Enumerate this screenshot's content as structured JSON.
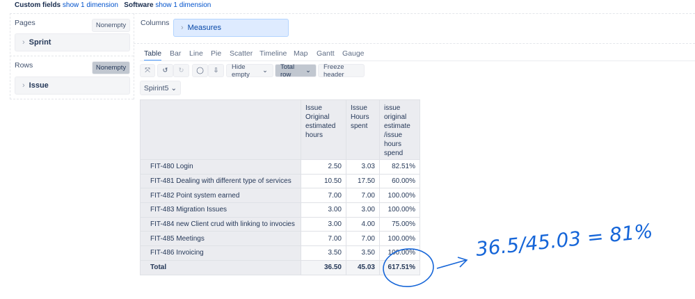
{
  "top_bar": [
    {
      "label": "Custom fields",
      "link": "show 1 dimension"
    },
    {
      "label": "Software",
      "link": "show 1 dimension"
    }
  ],
  "pages": {
    "label": "Pages",
    "nonempty": "Nonempty",
    "dimension": "Sprint"
  },
  "rows": {
    "label": "Rows",
    "nonempty": "Nonempty",
    "dimension": "Issue"
  },
  "columns": {
    "label": "Columns",
    "dimension": "Measures"
  },
  "tabs": [
    "Table",
    "Bar",
    "Line",
    "Pie",
    "Scatter",
    "Timeline",
    "Map",
    "Gantt",
    "Gauge"
  ],
  "toolbar": {
    "hide_empty": "Hide empty",
    "total_row": "Total row",
    "freeze_header": "Freeze header"
  },
  "page_filter": "Spirint5",
  "table": {
    "headers": [
      "Issue Original estimated hours",
      "Issue Hours spent",
      "issue original estimate /issue hours spend"
    ],
    "rows": [
      {
        "name": "FIT-480 Login",
        "v": [
          "2.50",
          "3.03",
          "82.51%"
        ]
      },
      {
        "name": "FIT-481 Dealing with different type of services",
        "v": [
          "10.50",
          "17.50",
          "60.00%"
        ]
      },
      {
        "name": "FIT-482 Point system earned",
        "v": [
          "7.00",
          "7.00",
          "100.00%"
        ]
      },
      {
        "name": "FIT-483 Migration Issues",
        "v": [
          "3.00",
          "3.00",
          "100.00%"
        ]
      },
      {
        "name": "FIT-484 new Client crud with linking to invocies",
        "v": [
          "3.00",
          "4.00",
          "75.00%"
        ]
      },
      {
        "name": "FIT-485 Meetings",
        "v": [
          "7.00",
          "7.00",
          "100.00%"
        ]
      },
      {
        "name": "FIT-486 Invoicing",
        "v": [
          "3.50",
          "3.50",
          "100.00%"
        ]
      }
    ],
    "total": {
      "name": "Total",
      "v": [
        "36.50",
        "45.03",
        "617.51%"
      ]
    }
  },
  "annotation": "36.5/45.03 = 81%",
  "colors": {
    "annotation": "#1565d8",
    "accent": "#4c9aff"
  }
}
